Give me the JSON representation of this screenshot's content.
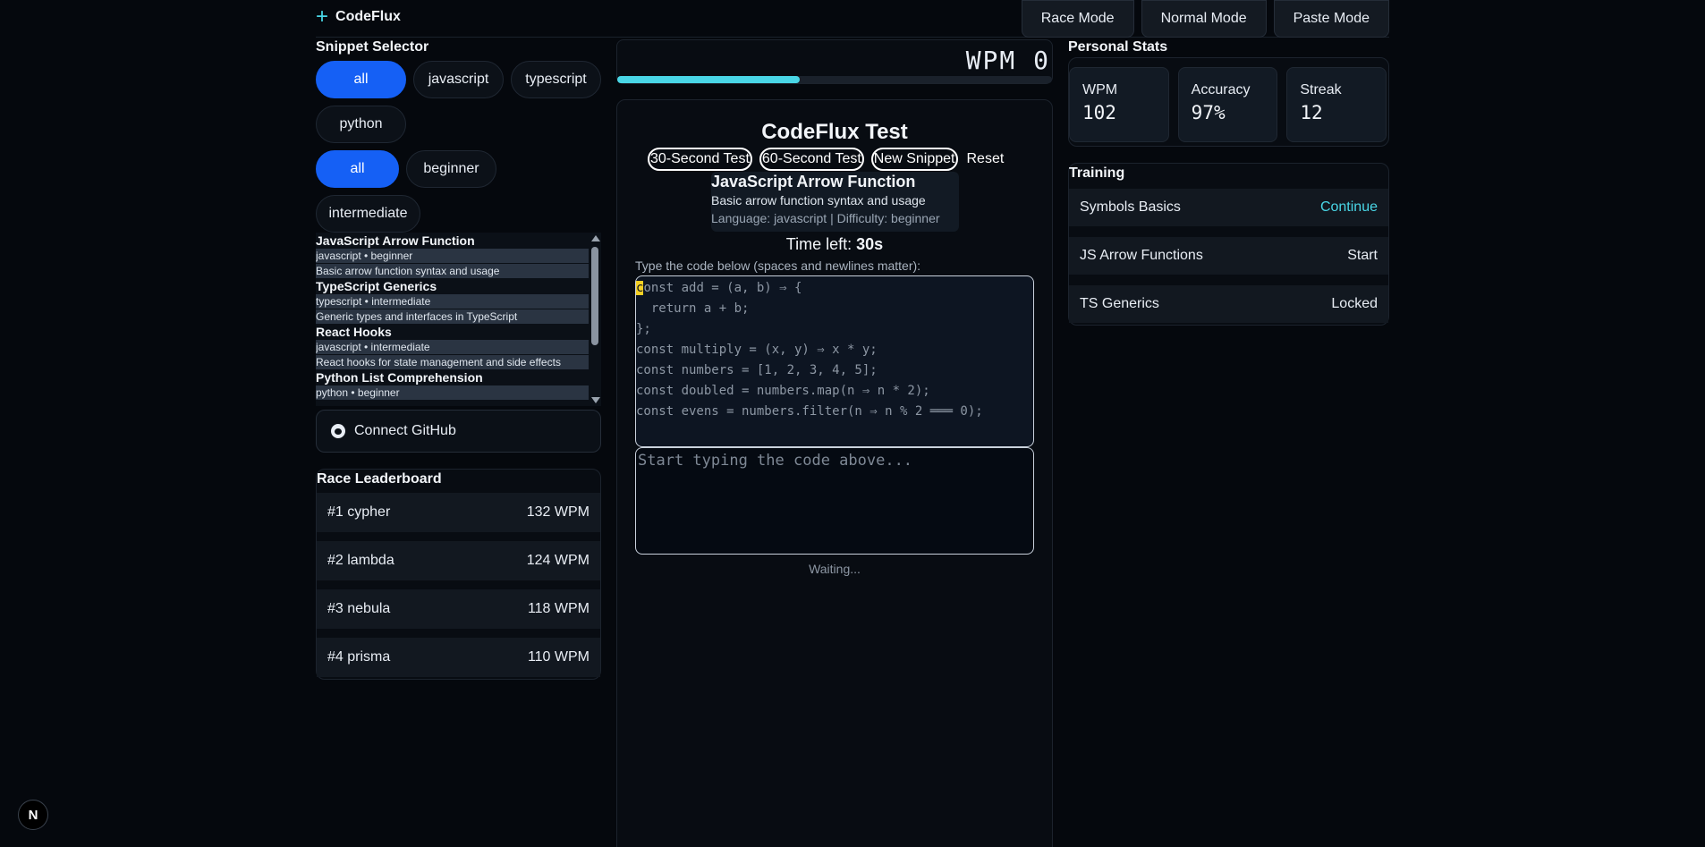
{
  "header": {
    "brand": "CodeFlux",
    "modes": [
      "Race Mode",
      "Normal Mode",
      "Paste Mode"
    ]
  },
  "snippet_selector": {
    "title": "Snippet Selector",
    "languages": [
      "all",
      "javascript",
      "typescript",
      "python"
    ],
    "active_language": "all",
    "difficulties": [
      "all",
      "beginner",
      "intermediate"
    ],
    "active_difficulty": "all",
    "snippets": [
      {
        "title": "JavaScript Arrow Function",
        "meta": "javascript • beginner",
        "desc": "Basic arrow function syntax and usage"
      },
      {
        "title": "TypeScript Generics",
        "meta": "typescript • intermediate",
        "desc": "Generic types and interfaces in TypeScript"
      },
      {
        "title": "React Hooks",
        "meta": "javascript • intermediate",
        "desc": "React hooks for state management and side effects"
      },
      {
        "title": "Python List Comprehension",
        "meta": "python • beginner",
        "desc": ""
      }
    ]
  },
  "github": {
    "label": "Connect GitHub"
  },
  "leaderboard": {
    "title": "Race Leaderboard",
    "rows": [
      {
        "rank": "#1 cypher",
        "wpm": "132 WPM"
      },
      {
        "rank": "#2 lambda",
        "wpm": "124 WPM"
      },
      {
        "rank": "#3 nebula",
        "wpm": "118 WPM"
      },
      {
        "rank": "#4 prisma",
        "wpm": "110 WPM"
      }
    ]
  },
  "wpm": {
    "display": "WPM 0",
    "progress_percent": 42
  },
  "test": {
    "title": "CodeFlux Test",
    "buttons": [
      "30-Second Test",
      "60-Second Test",
      "New Snippet"
    ],
    "reset": "Reset",
    "snippet_name": "JavaScript Arrow Function",
    "snippet_desc": "Basic arrow function syntax and usage",
    "snippet_lang": "Language: javascript | Difficulty: beginner",
    "time_label": "Time left: ",
    "time_value": "30s",
    "hint": "Type the code below (spaces and newlines matter):",
    "code_first_char": "c",
    "code_first_rest": "onst add = (a, b) ⇒ {",
    "code_lines": [
      "  return a + b;",
      "};",
      "const multiply = (x, y) ⇒ x * y;",
      "const numbers = [1, 2, 3, 4, 5];",
      "const doubled = numbers.map(n ⇒ n * 2);",
      "const evens = numbers.filter(n ⇒ n % 2 ═══ 0);"
    ],
    "input_placeholder": "Start typing the code above...",
    "status": "Waiting..."
  },
  "stats": {
    "title": "Personal Stats",
    "items": [
      {
        "label": "WPM",
        "value": "102"
      },
      {
        "label": "Accuracy",
        "value": "97%"
      },
      {
        "label": "Streak",
        "value": "12"
      }
    ]
  },
  "training": {
    "title": "Training",
    "rows": [
      {
        "name": "Symbols Basics",
        "action": "Continue"
      },
      {
        "name": "JS Arrow Functions",
        "action": "Start"
      },
      {
        "name": "TS Generics",
        "action": "Locked"
      }
    ]
  },
  "badge": "N",
  "colors": {
    "accent": "#49d6e6",
    "active_chip": "#1560f5",
    "cursor": "#f5d024"
  }
}
